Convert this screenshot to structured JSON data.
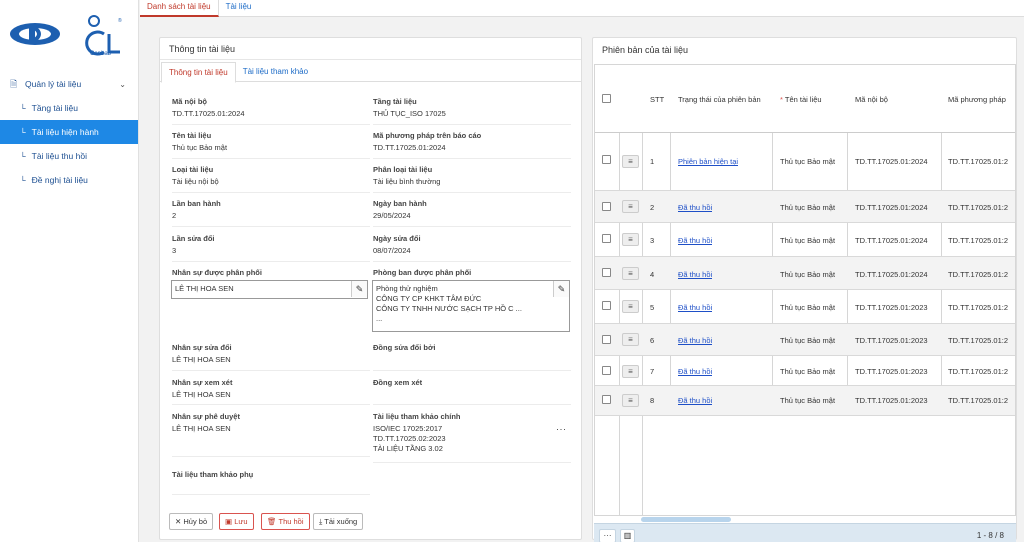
{
  "app": {
    "brand_name": "CenLab"
  },
  "colors": {
    "accent": "#1e88e5",
    "link": "#1e4fc7",
    "active_tab": "#c0392b",
    "footer": "#dce8f2"
  },
  "sidebar": {
    "group_label": "Quản lý tài liệu",
    "items": [
      {
        "label": "Tầng tài liệu",
        "active": false
      },
      {
        "label": "Tài liệu hiện hành",
        "active": true
      },
      {
        "label": "Tài liệu thu hồi",
        "active": false
      },
      {
        "label": "Đề nghị tài liệu",
        "active": false
      }
    ]
  },
  "top_tabs": [
    "Danh sách tài liệu",
    "Tài liệu"
  ],
  "info_panel": {
    "title": "Thông tin tài liệu",
    "tabs": [
      "Thông tin tài liệu",
      "Tài liệu tham khảo"
    ],
    "fields": {
      "ma_noi_bo": {
        "label": "Mã nội bộ",
        "value": "TD.TT.17025.01:2024"
      },
      "tang_tai_lieu": {
        "label": "Tầng tài liệu",
        "value": "THỦ TỤC_ISO 17025"
      },
      "ten_tai_lieu": {
        "label": "Tên tài liệu",
        "value": "Thủ tục Bảo mật"
      },
      "ma_phuong_phap": {
        "label": "Mã phương pháp trên báo cáo",
        "value": "TD.TT.17025.01:2024"
      },
      "loai_tai_lieu": {
        "label": "Loại tài liệu",
        "value": "Tài liệu nội bộ"
      },
      "phan_loai": {
        "label": "Phân loại tài liệu",
        "value": "Tài liệu bình thường"
      },
      "lan_ban_hanh": {
        "label": "Lần ban hành",
        "value": "2"
      },
      "ngay_ban_hanh": {
        "label": "Ngày ban hành",
        "value": "29/05/2024"
      },
      "lan_sua_doi": {
        "label": "Lần sửa đổi",
        "value": "3"
      },
      "ngay_sua_doi": {
        "label": "Ngày sửa đổi",
        "value": "08/07/2024"
      },
      "nhan_su_phan_phoi": {
        "label": "Nhân sự được phân phối",
        "value": "LÊ THỊ HOA SEN"
      },
      "phong_ban_phan_phoi": {
        "label": "Phòng ban được phân phối",
        "lines": [
          "Phòng thử nghiệm",
          "CÔNG TY CP KHKT TÂM ĐỨC",
          "CÔNG TY TNHH NƯỚC SẠCH TP HỒ C ...",
          "..."
        ]
      },
      "nhan_su_sua_doi": {
        "label": "Nhân sự sửa đổi",
        "value": "LÊ THỊ HOA SEN"
      },
      "dong_sua_doi": {
        "label": "Đồng sửa đổi bởi",
        "value": ""
      },
      "nhan_su_xem_xet": {
        "label": "Nhân sự xem xét",
        "value": "LÊ THỊ HOA SEN"
      },
      "dong_xem_xet": {
        "label": "Đồng xem xét",
        "value": ""
      },
      "nhan_su_phe_duyet": {
        "label": "Nhân sự phê duyệt",
        "value": "LÊ THỊ HOA SEN"
      },
      "tham_khao_chinh": {
        "label": "Tài liệu tham khảo chính",
        "lines": [
          "ISO/IEC 17025:2017",
          "TD.TT.17025.02:2023",
          "TÀI LIỆU TẦNG 3.02"
        ]
      },
      "tham_khao_phu": {
        "label": "Tài liệu tham khảo phụ",
        "value": ""
      }
    },
    "buttons": {
      "cancel": "Hủy bỏ",
      "save": "Lưu",
      "revoke": "Thu hồi",
      "download": "Tải xuống"
    }
  },
  "versions_panel": {
    "title": "Phiên bản của tài liệu",
    "columns": [
      "STT",
      "Trạng thái của phiên bản",
      "Tên tài liệu",
      "Mã nội bộ",
      "Mã phương pháp"
    ],
    "required_mark": "*",
    "rows": [
      {
        "stt": "1",
        "status": "Phiên bản hiện tại",
        "name": "Thủ tục Bảo mật",
        "code": "TD.TT.17025.01:2024",
        "method": "TD.TT.17025.01:2"
      },
      {
        "stt": "2",
        "status": "Đã thu hồi",
        "name": "Thủ tục Bảo mật",
        "code": "TD.TT.17025.01:2024",
        "method": "TD.TT.17025.01:2"
      },
      {
        "stt": "3",
        "status": "Đã thu hồi",
        "name": "Thủ tục Bảo mật",
        "code": "TD.TT.17025.01:2024",
        "method": "TD.TT.17025.01:2"
      },
      {
        "stt": "4",
        "status": "Đã thu hồi",
        "name": "Thủ tục Bảo mật",
        "code": "TD.TT.17025.01:2024",
        "method": "TD.TT.17025.01:2"
      },
      {
        "stt": "5",
        "status": "Đã thu hồi",
        "name": "Thủ tục Bảo mật",
        "code": "TD.TT.17025.01:2023",
        "method": "TD.TT.17025.01:2"
      },
      {
        "stt": "6",
        "status": "Đã thu hồi",
        "name": "Thủ tục Bảo mật",
        "code": "TD.TT.17025.01:2023",
        "method": "TD.TT.17025.01:2"
      },
      {
        "stt": "7",
        "status": "Đã thu hồi",
        "name": "Thủ tục Bảo mật",
        "code": "TD.TT.17025.01:2023",
        "method": "TD.TT.17025.01:2"
      },
      {
        "stt": "8",
        "status": "Đã thu hồi",
        "name": "Thủ tục Bảo mật",
        "code": "TD.TT.17025.01:2023",
        "method": "TD.TT.17025.01:2"
      }
    ],
    "footer": {
      "more": "···",
      "pager": "1 - 8 / 8"
    }
  }
}
